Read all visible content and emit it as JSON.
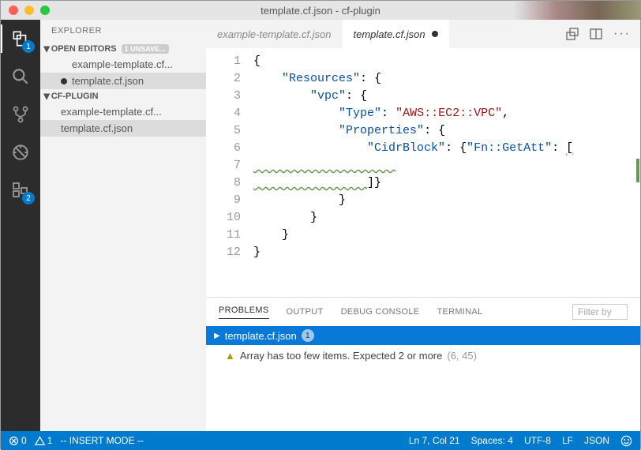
{
  "window": {
    "title": "template.cf.json - cf-plugin"
  },
  "activity": {
    "badges": {
      "explorer": "1",
      "extensions": "2"
    }
  },
  "sidebar": {
    "header": "EXPLORER",
    "openEditors": {
      "label": "OPEN EDITORS",
      "unsaved": "1 UNSAVE...",
      "items": [
        {
          "label": "example-template.cf...",
          "dirty": false
        },
        {
          "label": "template.cf.json",
          "dirty": true
        }
      ]
    },
    "folder": {
      "label": "CF-PLUGIN",
      "items": [
        {
          "label": "example-template.cf..."
        },
        {
          "label": "template.cf.json"
        }
      ]
    }
  },
  "tabs": [
    {
      "label": "example-template.cf.json",
      "active": false,
      "dirty": false
    },
    {
      "label": "template.cf.json",
      "active": true,
      "dirty": true
    }
  ],
  "code": {
    "lineNumbers": [
      "1",
      "2",
      "3",
      "4",
      "5",
      "6",
      "7",
      "8",
      "9",
      "10",
      "11",
      "12"
    ],
    "tokens": {
      "resources": "\"Resources\"",
      "vpc": "\"vpc\"",
      "type": "\"Type\"",
      "typeval": "\"AWS::EC2::VPC\"",
      "props": "\"Properties\"",
      "cidr": "\"CidrBlock\"",
      "getatt": "\"Fn::GetAtt\"",
      "closeArr": "]}",
      "brace": "{",
      "cbrace": "}",
      "colon": ":",
      "comma": ",",
      "obrack": "["
    }
  },
  "panel": {
    "tabs": {
      "problems": "PROBLEMS",
      "output": "OUTPUT",
      "debug": "DEBUG CONSOLE",
      "terminal": "TERMINAL"
    },
    "filter": "Filter by",
    "group": {
      "file": "template.cf.json",
      "count": "1"
    },
    "item": {
      "msg": "Array has too few items. Expected 2 or more",
      "loc": "(6, 45)"
    }
  },
  "status": {
    "errors": "0",
    "warnings": "1",
    "mode": "-- INSERT MODE --",
    "pos": "Ln 7, Col 21",
    "spaces": "Spaces: 4",
    "encoding": "UTF-8",
    "eol": "LF",
    "lang": "JSON"
  }
}
